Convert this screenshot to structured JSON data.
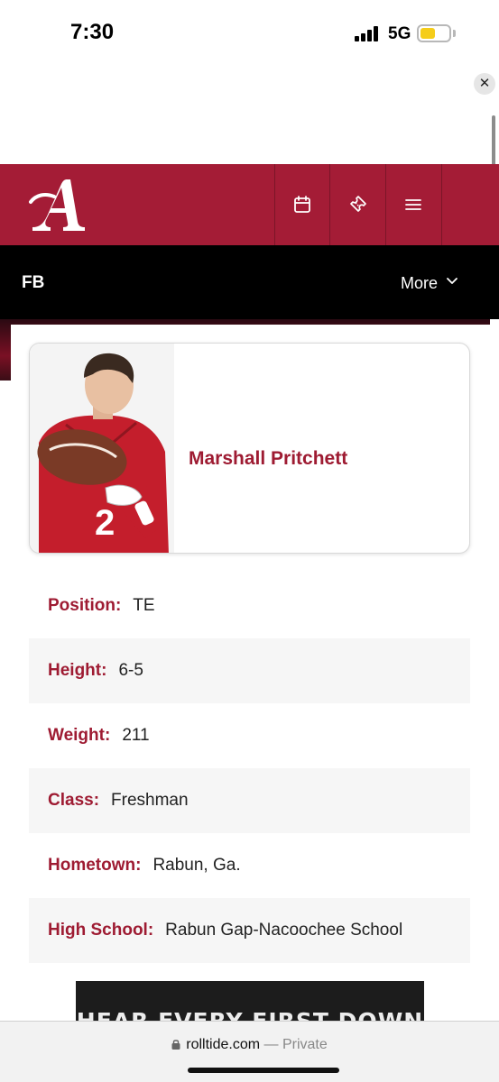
{
  "status_bar": {
    "time": "7:30",
    "network": "5G"
  },
  "icons": {
    "close": "close-icon",
    "calendar": "calendar-icon",
    "tickets": "ticket-icon",
    "menu": "hamburger-menu-icon",
    "chevron": "chevron-down-icon",
    "lock": "lock-icon"
  },
  "colors": {
    "crimson": "#a41c36",
    "label": "#9e1b32",
    "nav": "#000000"
  },
  "close_glyph": "✕",
  "subnav": {
    "title": "FB",
    "more_label": "More"
  },
  "player": {
    "name": "Marshall Pritchett"
  },
  "bio": [
    {
      "label": "Position:",
      "value": "TE"
    },
    {
      "label": "Height:",
      "value": "6-5"
    },
    {
      "label": "Weight:",
      "value": "211"
    },
    {
      "label": "Class:",
      "value": "Freshman"
    },
    {
      "label": "Hometown:",
      "value": "Rabun, Ga."
    },
    {
      "label": "High School:",
      "value": "Rabun Gap-Nacoochee School"
    }
  ],
  "promo": {
    "text": "HEAR EVERY FIRST DOWN"
  },
  "browser": {
    "domain": "rolltide.com",
    "privacy": "— Private"
  }
}
